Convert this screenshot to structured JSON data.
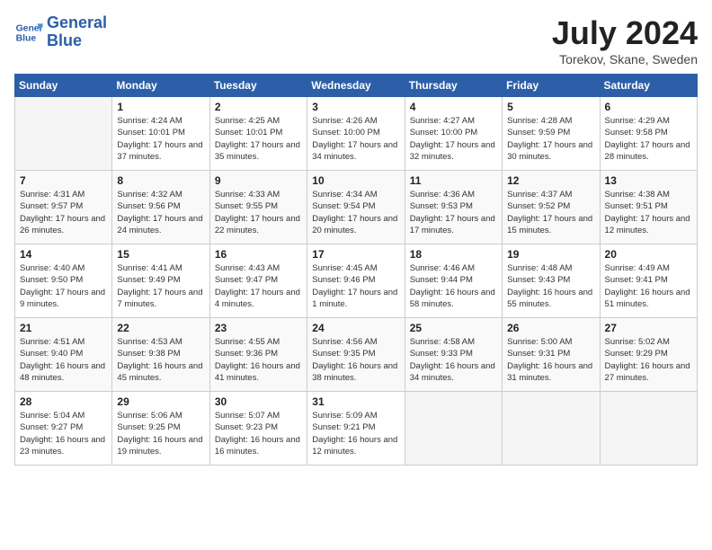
{
  "header": {
    "logo_line1": "General",
    "logo_line2": "Blue",
    "month_title": "July 2024",
    "subtitle": "Torekov, Skane, Sweden"
  },
  "days_of_week": [
    "Sunday",
    "Monday",
    "Tuesday",
    "Wednesday",
    "Thursday",
    "Friday",
    "Saturday"
  ],
  "weeks": [
    [
      {
        "day": "",
        "empty": true
      },
      {
        "day": "1",
        "sunrise": "Sunrise: 4:24 AM",
        "sunset": "Sunset: 10:01 PM",
        "daylight": "Daylight: 17 hours and 37 minutes."
      },
      {
        "day": "2",
        "sunrise": "Sunrise: 4:25 AM",
        "sunset": "Sunset: 10:01 PM",
        "daylight": "Daylight: 17 hours and 35 minutes."
      },
      {
        "day": "3",
        "sunrise": "Sunrise: 4:26 AM",
        "sunset": "Sunset: 10:00 PM",
        "daylight": "Daylight: 17 hours and 34 minutes."
      },
      {
        "day": "4",
        "sunrise": "Sunrise: 4:27 AM",
        "sunset": "Sunset: 10:00 PM",
        "daylight": "Daylight: 17 hours and 32 minutes."
      },
      {
        "day": "5",
        "sunrise": "Sunrise: 4:28 AM",
        "sunset": "Sunset: 9:59 PM",
        "daylight": "Daylight: 17 hours and 30 minutes."
      },
      {
        "day": "6",
        "sunrise": "Sunrise: 4:29 AM",
        "sunset": "Sunset: 9:58 PM",
        "daylight": "Daylight: 17 hours and 28 minutes."
      }
    ],
    [
      {
        "day": "7",
        "sunrise": "Sunrise: 4:31 AM",
        "sunset": "Sunset: 9:57 PM",
        "daylight": "Daylight: 17 hours and 26 minutes."
      },
      {
        "day": "8",
        "sunrise": "Sunrise: 4:32 AM",
        "sunset": "Sunset: 9:56 PM",
        "daylight": "Daylight: 17 hours and 24 minutes."
      },
      {
        "day": "9",
        "sunrise": "Sunrise: 4:33 AM",
        "sunset": "Sunset: 9:55 PM",
        "daylight": "Daylight: 17 hours and 22 minutes."
      },
      {
        "day": "10",
        "sunrise": "Sunrise: 4:34 AM",
        "sunset": "Sunset: 9:54 PM",
        "daylight": "Daylight: 17 hours and 20 minutes."
      },
      {
        "day": "11",
        "sunrise": "Sunrise: 4:36 AM",
        "sunset": "Sunset: 9:53 PM",
        "daylight": "Daylight: 17 hours and 17 minutes."
      },
      {
        "day": "12",
        "sunrise": "Sunrise: 4:37 AM",
        "sunset": "Sunset: 9:52 PM",
        "daylight": "Daylight: 17 hours and 15 minutes."
      },
      {
        "day": "13",
        "sunrise": "Sunrise: 4:38 AM",
        "sunset": "Sunset: 9:51 PM",
        "daylight": "Daylight: 17 hours and 12 minutes."
      }
    ],
    [
      {
        "day": "14",
        "sunrise": "Sunrise: 4:40 AM",
        "sunset": "Sunset: 9:50 PM",
        "daylight": "Daylight: 17 hours and 9 minutes."
      },
      {
        "day": "15",
        "sunrise": "Sunrise: 4:41 AM",
        "sunset": "Sunset: 9:49 PM",
        "daylight": "Daylight: 17 hours and 7 minutes."
      },
      {
        "day": "16",
        "sunrise": "Sunrise: 4:43 AM",
        "sunset": "Sunset: 9:47 PM",
        "daylight": "Daylight: 17 hours and 4 minutes."
      },
      {
        "day": "17",
        "sunrise": "Sunrise: 4:45 AM",
        "sunset": "Sunset: 9:46 PM",
        "daylight": "Daylight: 17 hours and 1 minute."
      },
      {
        "day": "18",
        "sunrise": "Sunrise: 4:46 AM",
        "sunset": "Sunset: 9:44 PM",
        "daylight": "Daylight: 16 hours and 58 minutes."
      },
      {
        "day": "19",
        "sunrise": "Sunrise: 4:48 AM",
        "sunset": "Sunset: 9:43 PM",
        "daylight": "Daylight: 16 hours and 55 minutes."
      },
      {
        "day": "20",
        "sunrise": "Sunrise: 4:49 AM",
        "sunset": "Sunset: 9:41 PM",
        "daylight": "Daylight: 16 hours and 51 minutes."
      }
    ],
    [
      {
        "day": "21",
        "sunrise": "Sunrise: 4:51 AM",
        "sunset": "Sunset: 9:40 PM",
        "daylight": "Daylight: 16 hours and 48 minutes."
      },
      {
        "day": "22",
        "sunrise": "Sunrise: 4:53 AM",
        "sunset": "Sunset: 9:38 PM",
        "daylight": "Daylight: 16 hours and 45 minutes."
      },
      {
        "day": "23",
        "sunrise": "Sunrise: 4:55 AM",
        "sunset": "Sunset: 9:36 PM",
        "daylight": "Daylight: 16 hours and 41 minutes."
      },
      {
        "day": "24",
        "sunrise": "Sunrise: 4:56 AM",
        "sunset": "Sunset: 9:35 PM",
        "daylight": "Daylight: 16 hours and 38 minutes."
      },
      {
        "day": "25",
        "sunrise": "Sunrise: 4:58 AM",
        "sunset": "Sunset: 9:33 PM",
        "daylight": "Daylight: 16 hours and 34 minutes."
      },
      {
        "day": "26",
        "sunrise": "Sunrise: 5:00 AM",
        "sunset": "Sunset: 9:31 PM",
        "daylight": "Daylight: 16 hours and 31 minutes."
      },
      {
        "day": "27",
        "sunrise": "Sunrise: 5:02 AM",
        "sunset": "Sunset: 9:29 PM",
        "daylight": "Daylight: 16 hours and 27 minutes."
      }
    ],
    [
      {
        "day": "28",
        "sunrise": "Sunrise: 5:04 AM",
        "sunset": "Sunset: 9:27 PM",
        "daylight": "Daylight: 16 hours and 23 minutes."
      },
      {
        "day": "29",
        "sunrise": "Sunrise: 5:06 AM",
        "sunset": "Sunset: 9:25 PM",
        "daylight": "Daylight: 16 hours and 19 minutes."
      },
      {
        "day": "30",
        "sunrise": "Sunrise: 5:07 AM",
        "sunset": "Sunset: 9:23 PM",
        "daylight": "Daylight: 16 hours and 16 minutes."
      },
      {
        "day": "31",
        "sunrise": "Sunrise: 5:09 AM",
        "sunset": "Sunset: 9:21 PM",
        "daylight": "Daylight: 16 hours and 12 minutes."
      },
      {
        "day": "",
        "empty": true
      },
      {
        "day": "",
        "empty": true
      },
      {
        "day": "",
        "empty": true
      }
    ]
  ]
}
